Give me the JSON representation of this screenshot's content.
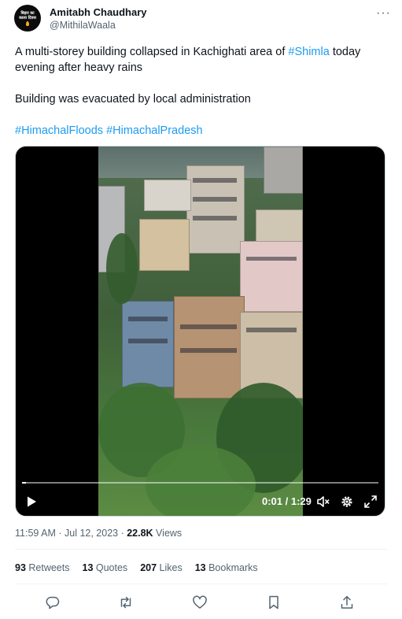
{
  "author": {
    "name": "Amitabh Chaudhary",
    "handle": "@MithilaWaala",
    "avatar_text": [
      "बिहार का",
      "काला दिवस"
    ]
  },
  "more_icon": "more-horizontal-icon",
  "tweet": {
    "line1_pre": "A multi-storey building collapsed in Kachighati area of ",
    "line1_link": "#Shimla",
    "line1_post": " today evening after heavy rains",
    "line2": "Building was evacuated by local administration",
    "tag1": "#HimachalFloods",
    "tag2": "#HimachalPradesh"
  },
  "video": {
    "time": "0:01 / 1:29",
    "progress": 0.012,
    "icons": [
      "play-icon",
      "mute-icon",
      "settings-icon",
      "fullscreen-icon"
    ]
  },
  "meta": {
    "time": "11:59 AM · Jul 12, 2023 · ",
    "views_count": "22.8K",
    "views_label": " Views"
  },
  "stats": {
    "retweets_count": "93",
    "retweets_label": " Retweets",
    "quotes_count": "13",
    "quotes_label": " Quotes",
    "likes_count": "207",
    "likes_label": " Likes",
    "bookmarks_count": "13",
    "bookmarks_label": " Bookmarks"
  },
  "action_icons": [
    "reply-icon",
    "retweet-icon",
    "like-icon",
    "bookmark-icon",
    "share-icon"
  ],
  "colors": {
    "link": "#1d9bf0",
    "text": "#0f1419",
    "secondary": "#536471"
  }
}
